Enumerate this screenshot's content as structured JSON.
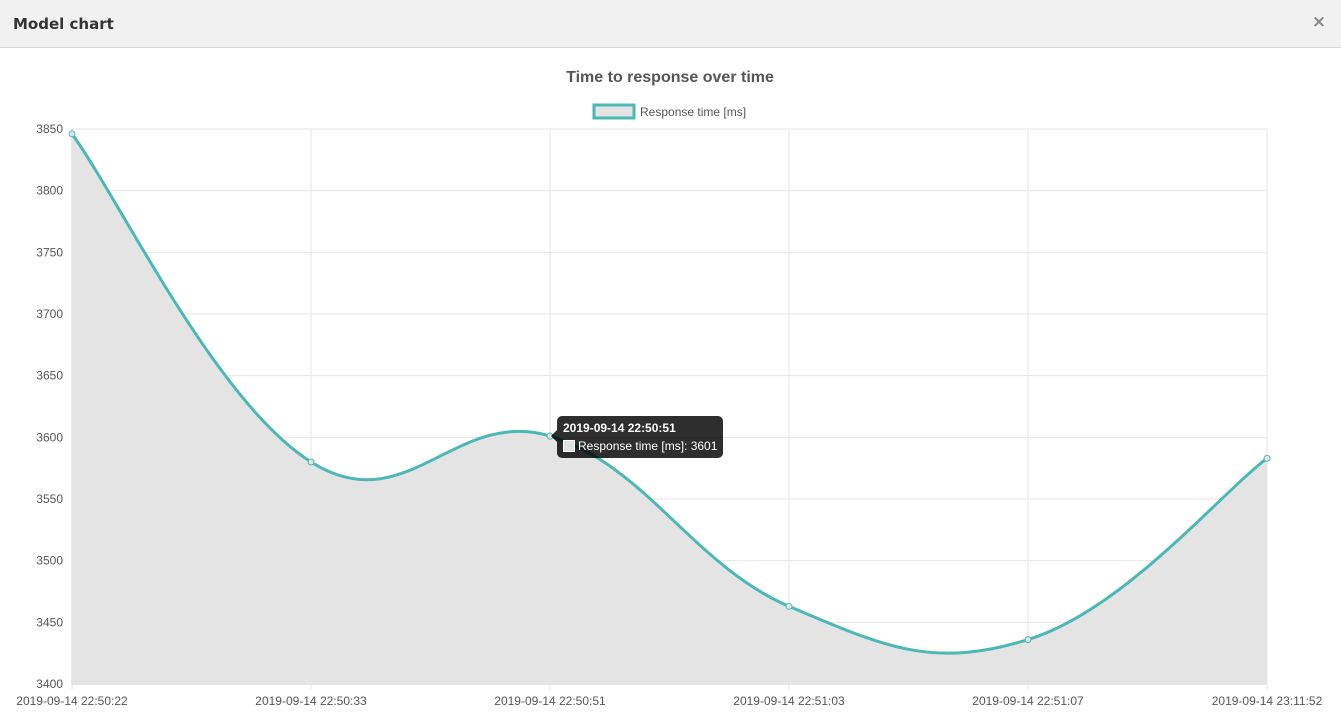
{
  "modal": {
    "title": "Model chart",
    "close_label": "×"
  },
  "tooltip": {
    "title": "2019-09-14 22:50:51",
    "label": "Response time [ms]: 3601",
    "color": "#e0e0e0"
  },
  "colors": {
    "line": "#4bb8b6",
    "fill": "#e4e4e4",
    "grid": "#e6e6e6",
    "text": "#555555"
  },
  "chart_data": {
    "type": "line",
    "title": "Time to response over time",
    "legend_position": "top-center",
    "grid": true,
    "categories": [
      "2019-09-14 22:50:22",
      "2019-09-14 22:50:33",
      "2019-09-14 22:50:51",
      "2019-09-14 22:51:03",
      "2019-09-14 22:51:07",
      "2019-09-14 23:11:52"
    ],
    "series": [
      {
        "name": "Response time [ms]",
        "values": [
          3846,
          3580,
          3601,
          3463,
          3436,
          3583
        ]
      }
    ],
    "ylim": [
      3400,
      3850
    ],
    "yticks": [
      3400,
      3450,
      3500,
      3550,
      3600,
      3650,
      3700,
      3750,
      3800,
      3850
    ]
  }
}
